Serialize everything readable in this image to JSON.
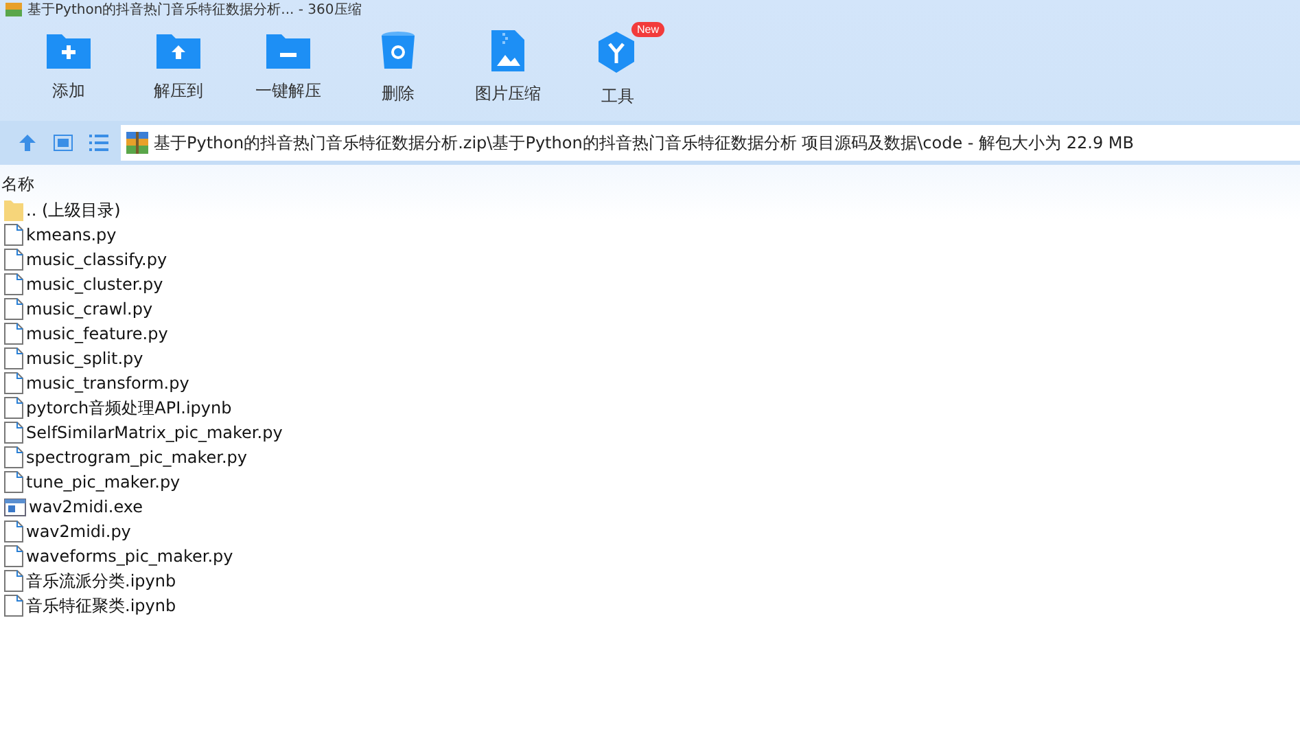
{
  "window": {
    "title": "基于Python的抖音热门音乐特征数据分析... - 360压缩"
  },
  "toolbar": [
    {
      "label": "添加",
      "kind": "add"
    },
    {
      "label": "解压到",
      "kind": "extract"
    },
    {
      "label": "一键解压",
      "kind": "oneclick"
    },
    {
      "label": "删除",
      "kind": "delete"
    },
    {
      "label": "图片压缩",
      "kind": "image"
    },
    {
      "label": "工具",
      "kind": "tools",
      "badge": "New"
    }
  ],
  "address": {
    "path": "基于Python的抖音热门音乐特征数据分析.zip\\基于Python的抖音热门音乐特征数据分析 项目源码及数据\\code - 解包大小为 22.9 MB"
  },
  "table": {
    "columns": [
      "名称"
    ],
    "rows": [
      {
        "name": ".. (上级目录)",
        "kind": "folder"
      },
      {
        "name": "kmeans.py",
        "kind": "file"
      },
      {
        "name": "music_classify.py",
        "kind": "file"
      },
      {
        "name": "music_cluster.py",
        "kind": "file"
      },
      {
        "name": "music_crawl.py",
        "kind": "file"
      },
      {
        "name": "music_feature.py",
        "kind": "file"
      },
      {
        "name": "music_split.py",
        "kind": "file"
      },
      {
        "name": "music_transform.py",
        "kind": "file"
      },
      {
        "name": "pytorch音频处理API.ipynb",
        "kind": "file"
      },
      {
        "name": "SelfSimilarMatrix_pic_maker.py",
        "kind": "file"
      },
      {
        "name": "spectrogram_pic_maker.py",
        "kind": "file"
      },
      {
        "name": "tune_pic_maker.py",
        "kind": "file"
      },
      {
        "name": "wav2midi.exe",
        "kind": "exe"
      },
      {
        "name": "wav2midi.py",
        "kind": "file"
      },
      {
        "name": "waveforms_pic_maker.py",
        "kind": "file"
      },
      {
        "name": "音乐流派分类.ipynb",
        "kind": "file"
      },
      {
        "name": "音乐特征聚类.ipynb",
        "kind": "file"
      }
    ]
  }
}
